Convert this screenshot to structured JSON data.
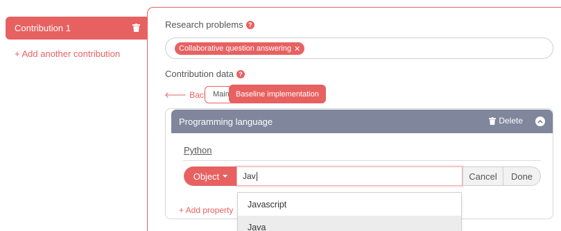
{
  "sidebar": {
    "contribution_label": "Contribution 1",
    "add_contribution": "+ Add another contribution"
  },
  "research_problems": {
    "label": "Research problems",
    "chips": [
      {
        "label": "Collaborative question answering"
      }
    ]
  },
  "contribution_data": {
    "label": "Contribution data",
    "back_label": "Back",
    "main_label": "Main",
    "tooltip": "Baseline implementation"
  },
  "property": {
    "title": "Programming language",
    "delete_label": "Delete",
    "existing_value": "Python",
    "object_type": "Object",
    "input_value": "Jav",
    "cancel_label": "Cancel",
    "done_label": "Done",
    "add_property": "+ Add property",
    "suggestions": [
      {
        "label": "Javascript",
        "active": false
      },
      {
        "label": "Java",
        "active": true
      }
    ]
  },
  "colors": {
    "accent": "#e86161",
    "card_header": "#80869b"
  },
  "icons": {
    "trash": "trash-icon",
    "help": "question-circle-icon",
    "back": "arrow-left-icon",
    "collapse": "chevron-up-circle-icon",
    "caret": "caret-down-icon",
    "remove": "close-icon"
  }
}
